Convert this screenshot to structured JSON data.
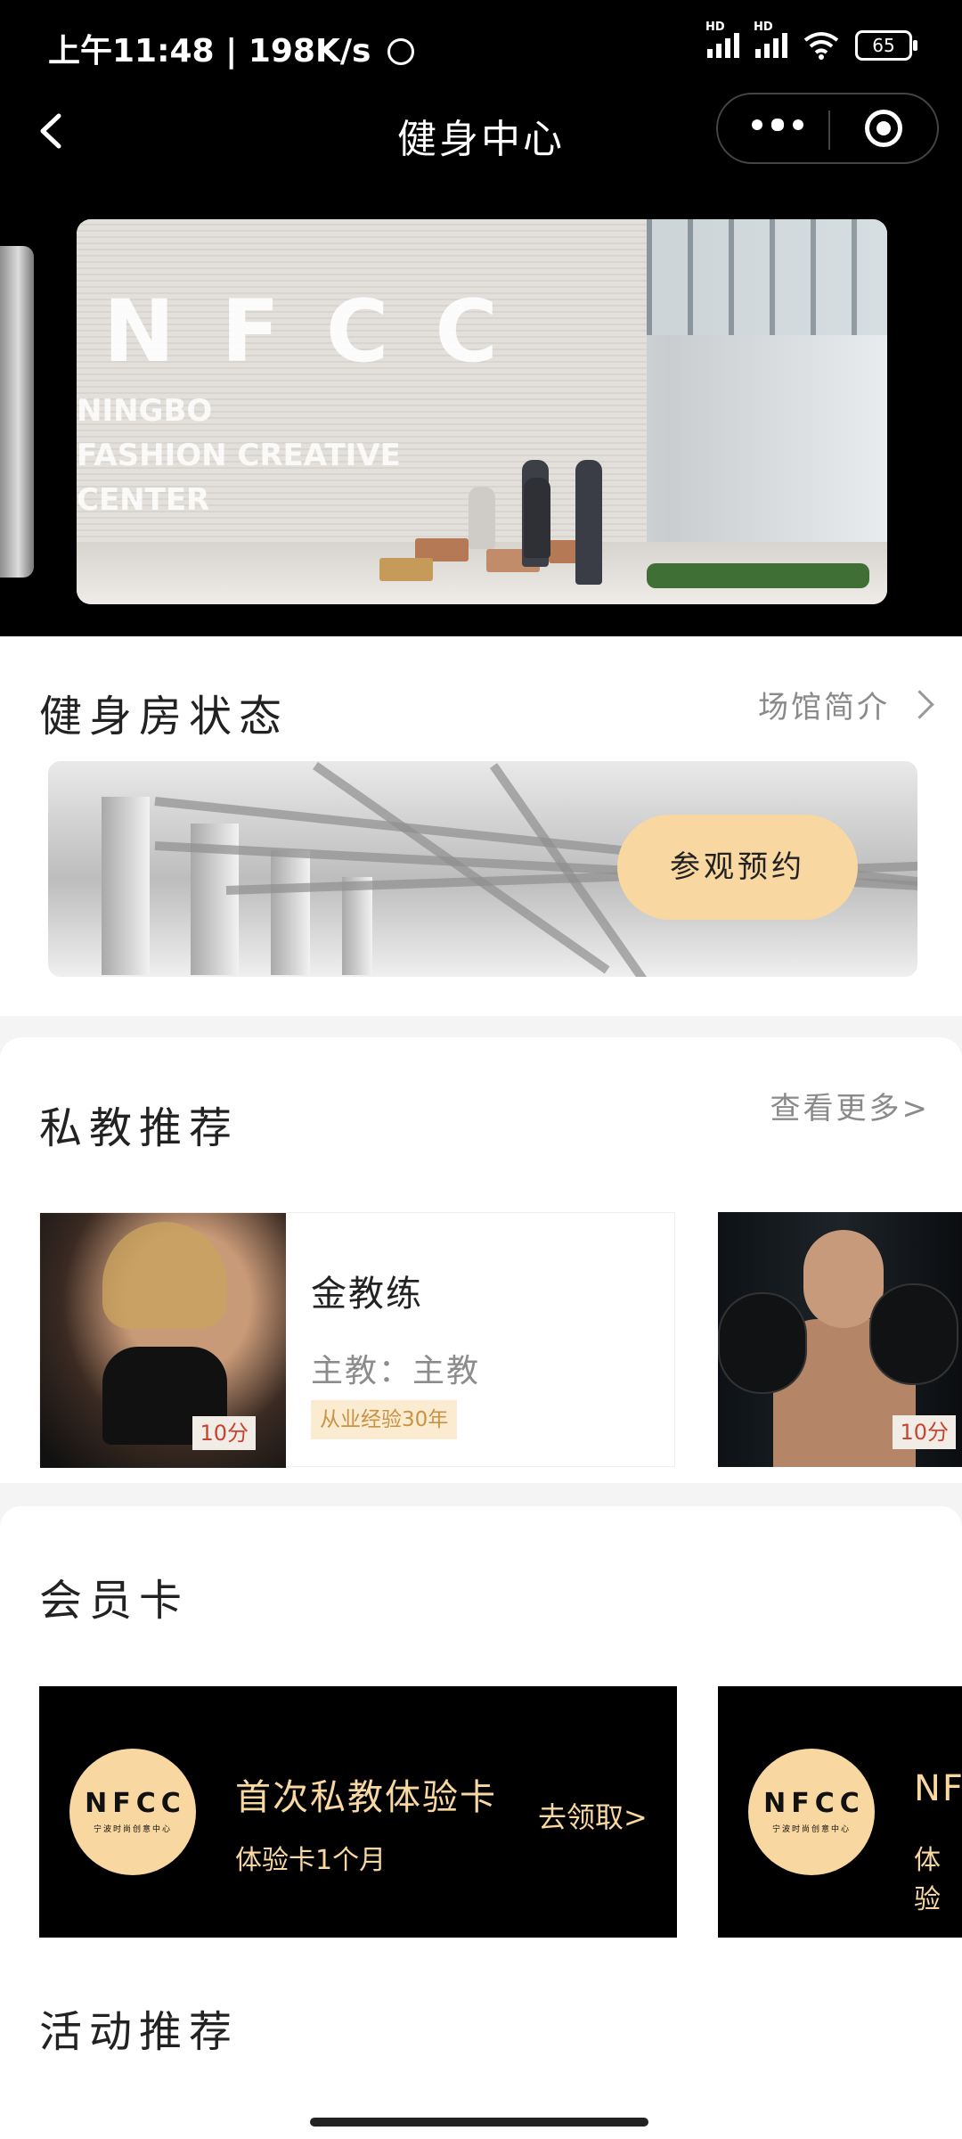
{
  "status_bar": {
    "time": "上午11:48",
    "speed": "198K/s",
    "hd": "HD",
    "battery": "65"
  },
  "nav": {
    "title": "健身中心"
  },
  "banner": {
    "logo": "NFCC",
    "sub_lines": [
      "NINGBO",
      "FASHION CREATIVE",
      "CENTER"
    ]
  },
  "gym_status": {
    "title": "健身房状态",
    "more": "场馆简介",
    "visit_button": "参观预约"
  },
  "coaches": {
    "title": "私教推荐",
    "more": "查看更多>",
    "items": [
      {
        "name": "金教练",
        "role": "主教：主教",
        "experience": "从业经验30年",
        "score": "10分"
      },
      {
        "score": "10分"
      }
    ]
  },
  "membership": {
    "title": "会员卡",
    "cards": [
      {
        "logo": "NFCC",
        "logo_sub": "宁波时尚创意中心",
        "name": "首次私教体验卡",
        "sub": "体验卡1个月",
        "action": "去领取>"
      },
      {
        "logo": "NFCC",
        "logo_sub": "宁波时尚创意中心",
        "name": "NF",
        "sub": "体验"
      }
    ]
  },
  "activities": {
    "title": "活动推荐"
  },
  "colors": {
    "accent": "#f9d7a1",
    "score_red": "#c8442f",
    "tag_text": "#c99245"
  }
}
